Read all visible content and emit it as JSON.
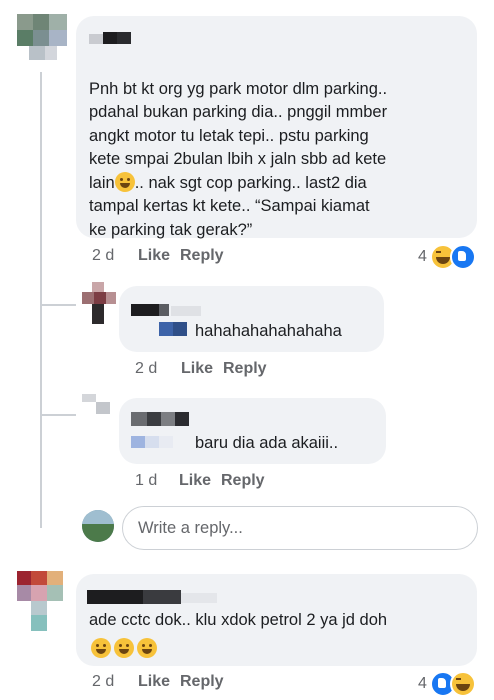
{
  "comments": [
    {
      "text": "Pnh bt kt org yg park motor dlm parking..\npdahal bukan parking dia.. pnggil mmber\nangkt motor tu letak tepi.. pstu parking\nkete  smpai 2bulan lbih x jaln sbb ad kete\nlain",
      "text_after_emoji": ".. nak sgt cop parking.. last2 dia",
      "text_tail": "tampal kertas kt kete.. “Sampai kiamat\nke parking tak gerak?”",
      "time": "2 d",
      "like": "Like",
      "reply": "Reply",
      "reaction_count": "4"
    },
    {
      "text": "hahahahahahahaha",
      "time": "2 d",
      "like": "Like",
      "reply": "Reply"
    },
    {
      "text": "baru dia  ada akaiii..",
      "time": "1 d",
      "like": "Like",
      "reply": "Reply"
    },
    {
      "text": "ade cctc dok.. klu xdok petrol 2 ya jd doh",
      "time": "2 d",
      "like": "Like",
      "reply": "Reply",
      "reaction_count": "4"
    }
  ],
  "reply_box": {
    "placeholder": "Write a reply..."
  },
  "colors": {
    "bubble": "#f0f2f5",
    "meta": "#65676b",
    "like_blue": "#1877f2",
    "haha_yellow": "#f7c23a"
  },
  "icons": [
    "grinning-sweat-emoji",
    "haha-reaction-icon",
    "like-reaction-icon",
    "hushed-face-emoji"
  ]
}
